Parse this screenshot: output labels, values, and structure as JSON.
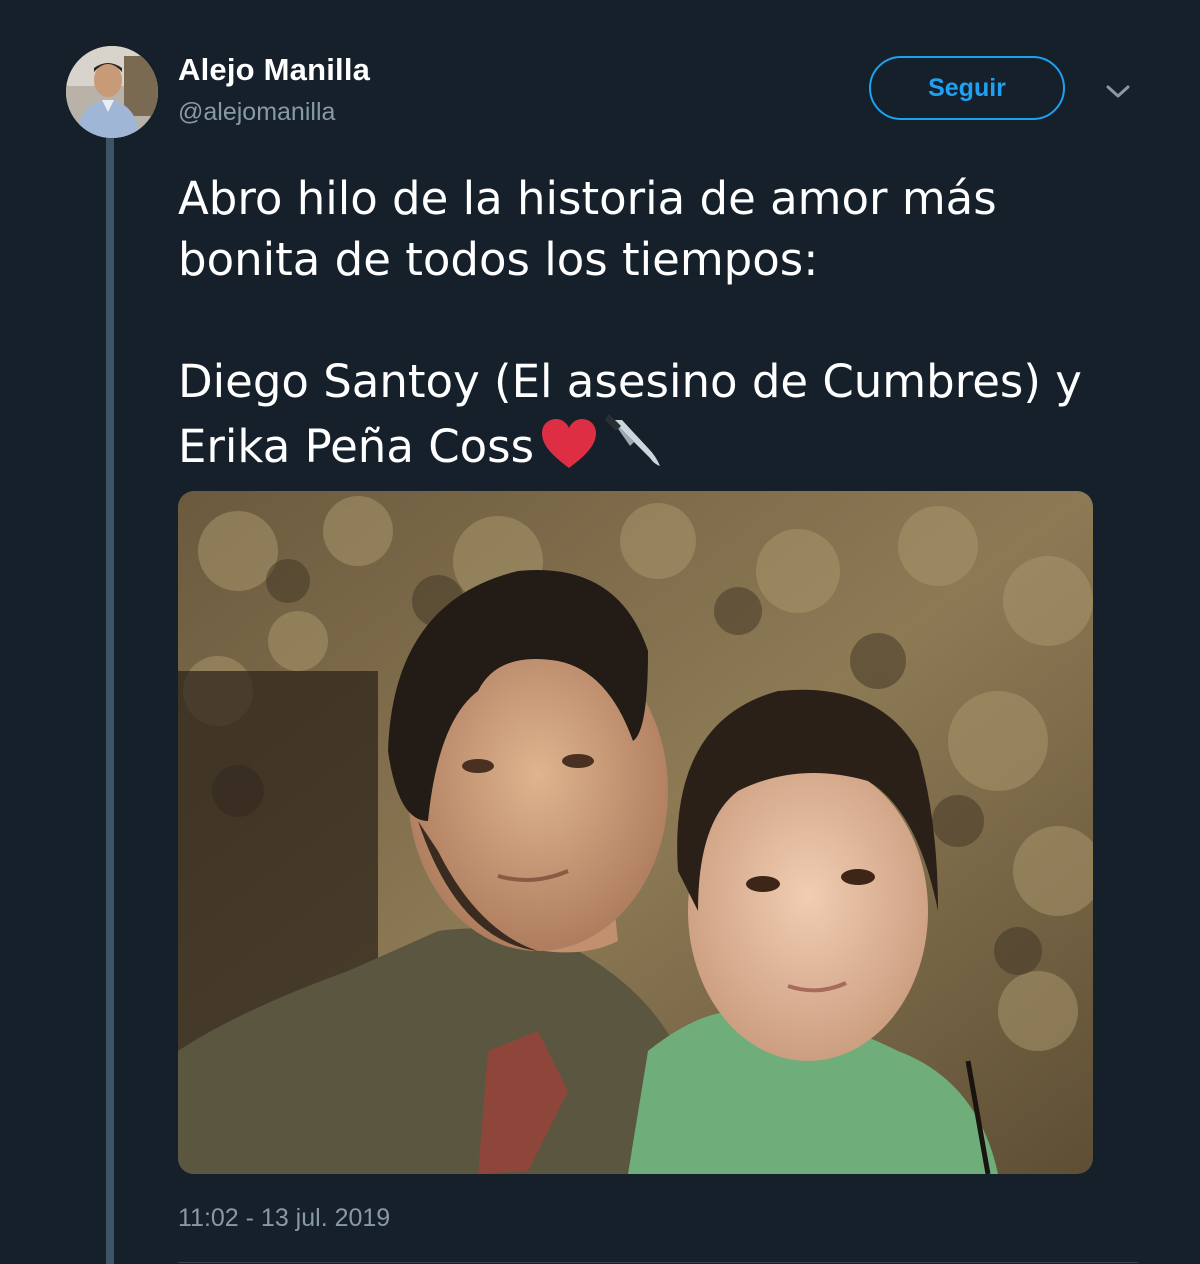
{
  "author": {
    "display_name": "Alejo Manilla",
    "handle": "@alejomanilla"
  },
  "actions": {
    "follow_label": "Seguir",
    "menu_icon": "chevron-down-icon"
  },
  "tweet": {
    "line1": "Abro hilo de la historia de amor más bonita de todos los tiempos:",
    "line2": "Diego Santoy (El asesino de Cumbres) y Erika Peña Coss",
    "emojis": [
      "red-heart-emoji",
      "kitchen-knife-emoji"
    ],
    "timestamp": "11:02 - 13 jul. 2019"
  },
  "colors": {
    "background": "#15202b",
    "accent": "#1da1f2",
    "secondary_text": "#8899a6",
    "thread_line": "#3d5466"
  }
}
